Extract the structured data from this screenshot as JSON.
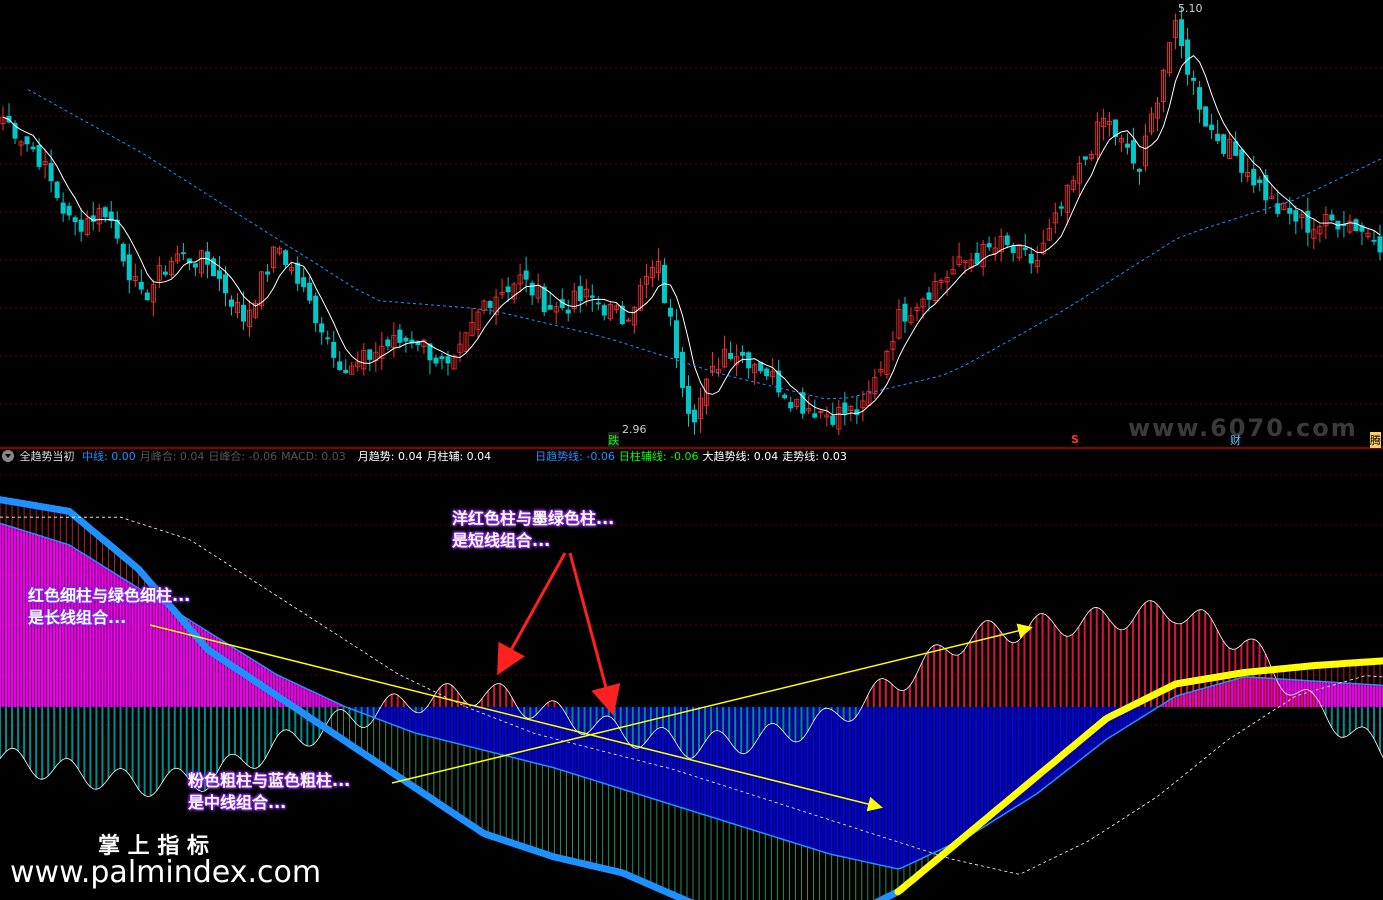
{
  "header": {
    "indicator_name": "全趋势当初",
    "items": [
      {
        "label": "中线",
        "value": "0.00",
        "color": "#1e90ff"
      },
      {
        "label": "月峰合",
        "value": "0.04",
        "color": "#555555"
      },
      {
        "label": "日峰合",
        "value": "-0.06",
        "color": "#555555"
      },
      {
        "label": "MACD",
        "value": "0.03",
        "color": "#555555"
      },
      {
        "label": "月趋势",
        "value": "0.04",
        "color": "#ffffff"
      },
      {
        "label": "月柱辅",
        "value": "0.04",
        "color": "#ffffff"
      },
      {
        "label": "日趋势线",
        "value": "-0.06",
        "color": "#1e90ff"
      },
      {
        "label": "日柱辅线",
        "value": "-0.06",
        "color": "#00ff00"
      },
      {
        "label": "大趋势线",
        "value": "0.04",
        "color": "#ffffff"
      },
      {
        "label": "走势线",
        "value": "0.03",
        "color": "#ffffff"
      }
    ]
  },
  "price_panel": {
    "high_label": "5.10",
    "low_label": "2.96",
    "markers": {
      "die": "跌",
      "s": "S",
      "cai": "财",
      "teng": "腾"
    },
    "watermark": "www.6070.com"
  },
  "annotations": {
    "short_line": [
      "洋红色柱与墨绿色柱...",
      "是短线组合..."
    ],
    "long_line": [
      "红色细柱与绿色细柱...",
      "是长线组合..."
    ],
    "mid_line": [
      "粉色粗柱与蓝色粗柱...",
      "是中线组合..."
    ]
  },
  "brand": {
    "title": "掌 上 指 标",
    "url": "www.palmindex.com"
  },
  "colors": {
    "up": "#ff3030",
    "down": "#00c8c8",
    "ma": "#ffffff",
    "long_ma": "#1e90ff",
    "magenta": "#ff00ff",
    "blue_bar": "#0000dd",
    "red_thin": "#b22222",
    "green_thin": "#2e8b57",
    "crimson": "#dc143c",
    "teal": "#008b8b",
    "blue_line": "#1e90ff",
    "yellow_line": "#ffff00",
    "arrow_red": "#ff2020",
    "arrow_yellow": "#ffff00"
  },
  "chart_data": [
    {
      "type": "candlestick",
      "title": "",
      "series": [
        {
          "values": [
            4.6,
            4.4,
            4.0,
            4.1,
            3.6,
            3.85,
            3.8,
            3.5,
            3.9,
            3.55,
            3.2,
            3.35,
            3.4,
            3.2,
            3.6,
            3.72,
            3.55,
            3.62,
            3.5,
            3.8,
            2.96,
            3.35,
            3.25,
            3.05,
            2.98,
            3.0,
            3.5,
            3.68,
            3.82,
            3.9,
            3.8,
            4.2,
            4.6,
            4.3,
            5.1,
            4.55,
            4.35,
            4.1,
            4.0,
            4.05,
            3.92
          ]
        }
      ],
      "ylim": [
        2.8,
        5.2
      ]
    },
    {
      "type": "area",
      "title": "",
      "series": [
        {
          "values": [
            0.9,
            0.85,
            0.6,
            0.25,
            0.05,
            -0.15,
            -0.35,
            -0.55,
            -0.65,
            -0.72,
            -0.85,
            -0.9,
            -0.95,
            -0.8,
            -0.55,
            -0.3,
            -0.05,
            0.1,
            0.15,
            0.18,
            0.2
          ]
        },
        {
          "values": [
            -0.4,
            -0.5,
            -0.6,
            -0.55,
            -0.3,
            -0.1,
            0.05,
            0.12,
            -0.05,
            -0.2,
            -0.3,
            -0.25,
            -0.1,
            0.2,
            0.55,
            0.62,
            0.68,
            0.75,
            0.5,
            0.0,
            -0.35
          ]
        },
        {
          "values": [
            0.85,
            0.75,
            0.55,
            0.35,
            0.15,
            0.0,
            -0.12,
            -0.2,
            -0.28,
            -0.38,
            -0.48,
            -0.58,
            -0.68,
            -0.75,
            -0.6,
            -0.4,
            -0.15,
            0.05,
            0.14,
            0.12,
            0.1
          ]
        }
      ],
      "ylim": [
        -1,
        1
      ]
    }
  ]
}
